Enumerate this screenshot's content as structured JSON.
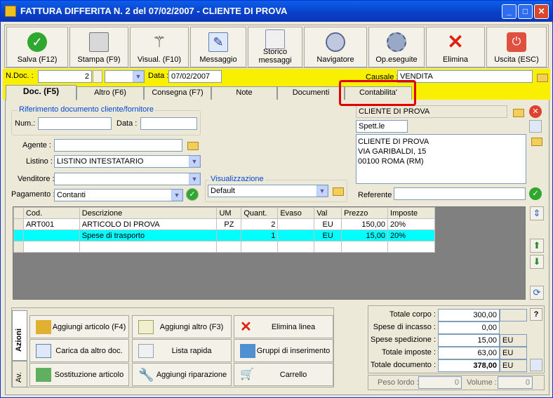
{
  "window": {
    "title": "FATTURA DIFFERITA N. 2  del 07/02/2007 - CLIENTE DI PROVA"
  },
  "toolbar": [
    {
      "label": "Salva (F12)",
      "icon": "check-icon"
    },
    {
      "label": "Stampa (F9)",
      "icon": "printer-icon"
    },
    {
      "label": "Visual. (F10)",
      "icon": "magic-wand-icon"
    },
    {
      "label": "Messaggio",
      "icon": "pen-icon"
    },
    {
      "label": "Storico\nmessaggi",
      "icon": "magnifier-icon"
    },
    {
      "label": "Navigatore",
      "icon": "compass-icon"
    },
    {
      "label": "Op.eseguite",
      "icon": "gears-icon"
    },
    {
      "label": "Elimina",
      "icon": "x-icon"
    },
    {
      "label": "Uscita (ESC)",
      "icon": "power-icon"
    }
  ],
  "header": {
    "ndoc_label": "N.Doc. :",
    "ndoc_value": "2",
    "data_label": "Data :",
    "data_value": "07/02/2007",
    "causale_label": "Causale :",
    "causale_value": "VENDITA"
  },
  "tabs": [
    "Doc. (F5)",
    "Altro (F6)",
    "Consegna (F7)",
    "Note",
    "Documenti",
    "Contabilita'"
  ],
  "form": {
    "rif_label": "Riferimento documento cliente/fornitore",
    "num_label": "Num.:",
    "num_value": "",
    "data_label": "Data :",
    "data_value": "",
    "agente_label": "Agente :",
    "agente_value": "",
    "listino_label": "Listino :",
    "listino_value": "LISTINO INTESTATARIO",
    "venditore_label": "Venditore :",
    "venditore_value": "",
    "pagamento_label": "Pagamento :",
    "pagamento_value": "Contanti",
    "visual_label": "Visualizzazione",
    "visual_value": "Default"
  },
  "customer": {
    "name": "CLIENTE DI PROVA",
    "title": "Spett.le",
    "address_line1": "CLIENTE DI PROVA",
    "address_line2": "VIA GARIBALDI, 15",
    "address_line3": "00100 ROMA (RM)",
    "referente_label": "Referente",
    "referente_value": ""
  },
  "grid": {
    "columns": [
      "Cod.",
      "Descrizione",
      "UM",
      "Quant.",
      "Evaso",
      "Val",
      "Prezzo",
      "Imposte"
    ],
    "rows": [
      [
        "ART001",
        "ARTICOLO DI PROVA",
        "PZ",
        "2",
        "",
        "EU",
        "150,00",
        "20%"
      ],
      [
        "",
        "Spese di trasporto",
        "",
        "1",
        "",
        "EU",
        "15,00",
        "20%"
      ],
      [
        "",
        "",
        "",
        "",
        "",
        "",
        "",
        ""
      ]
    ]
  },
  "actions": {
    "vtab1": "Azioni",
    "vtab2": "Av.",
    "buttons": [
      "Aggiungi articolo (F4)",
      "Aggiungi altro (F3)",
      "Elimina linea",
      "Carica da altro doc.",
      "Lista rapida",
      "Gruppi di inserimento",
      "Sostituzione articolo",
      "Aggiungi riparazione",
      "Carrello"
    ]
  },
  "totals": {
    "totale_corpo_label": "Totale corpo :",
    "totale_corpo": "300,00",
    "spese_incasso_label": "Spese di incasso :",
    "spese_incasso": "0,00",
    "spese_spedizione_label": "Spese spedizione :",
    "spese_spedizione": "15,00",
    "totale_imposte_label": "Totale imposte :",
    "totale_imposte": "63,00",
    "totale_documento_label": "Totale documento :",
    "totale_documento": "378,00",
    "currency": "EU",
    "help": "?",
    "peso_lordo_label": "Peso lordo :",
    "peso_lordo": "0",
    "volume_label": "Volume :",
    "volume": "0"
  }
}
